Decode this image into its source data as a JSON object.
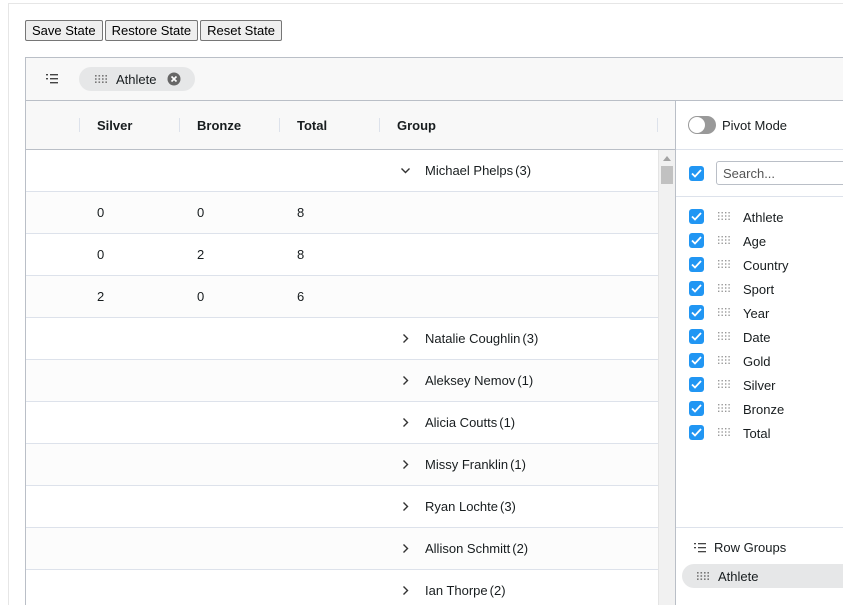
{
  "toolbar": {
    "save_label": "Save State",
    "restore_label": "Restore State",
    "reset_label": "Reset State"
  },
  "group_panel": {
    "chip_label": "Athlete"
  },
  "columns": {
    "silver": "Silver",
    "bronze": "Bronze",
    "total": "Total",
    "group": "Group"
  },
  "rows": [
    {
      "type": "group",
      "expanded": true,
      "name": "Michael Phelps",
      "count": "(3)"
    },
    {
      "type": "data",
      "silver": "0",
      "bronze": "0",
      "total": "8"
    },
    {
      "type": "data",
      "silver": "0",
      "bronze": "2",
      "total": "8"
    },
    {
      "type": "data",
      "silver": "2",
      "bronze": "0",
      "total": "6"
    },
    {
      "type": "group",
      "expanded": false,
      "name": "Natalie Coughlin",
      "count": "(3)"
    },
    {
      "type": "group",
      "expanded": false,
      "name": "Aleksey Nemov",
      "count": "(1)"
    },
    {
      "type": "group",
      "expanded": false,
      "name": "Alicia Coutts",
      "count": "(1)"
    },
    {
      "type": "group",
      "expanded": false,
      "name": "Missy Franklin",
      "count": "(1)"
    },
    {
      "type": "group",
      "expanded": false,
      "name": "Ryan Lochte",
      "count": "(3)"
    },
    {
      "type": "group",
      "expanded": false,
      "name": "Allison Schmitt",
      "count": "(2)"
    },
    {
      "type": "group",
      "expanded": false,
      "name": "Ian Thorpe",
      "count": "(2)"
    }
  ],
  "side_panel": {
    "pivot_mode_label": "Pivot Mode",
    "search_placeholder": "Search...",
    "column_list": [
      "Athlete",
      "Age",
      "Country",
      "Sport",
      "Year",
      "Date",
      "Gold",
      "Silver",
      "Bronze",
      "Total"
    ],
    "row_groups_title": "Row Groups",
    "row_group_item": "Athlete"
  },
  "colors": {
    "accent": "#2196f3",
    "header_bg": "#f8f8f8",
    "border": "#babfc7"
  }
}
